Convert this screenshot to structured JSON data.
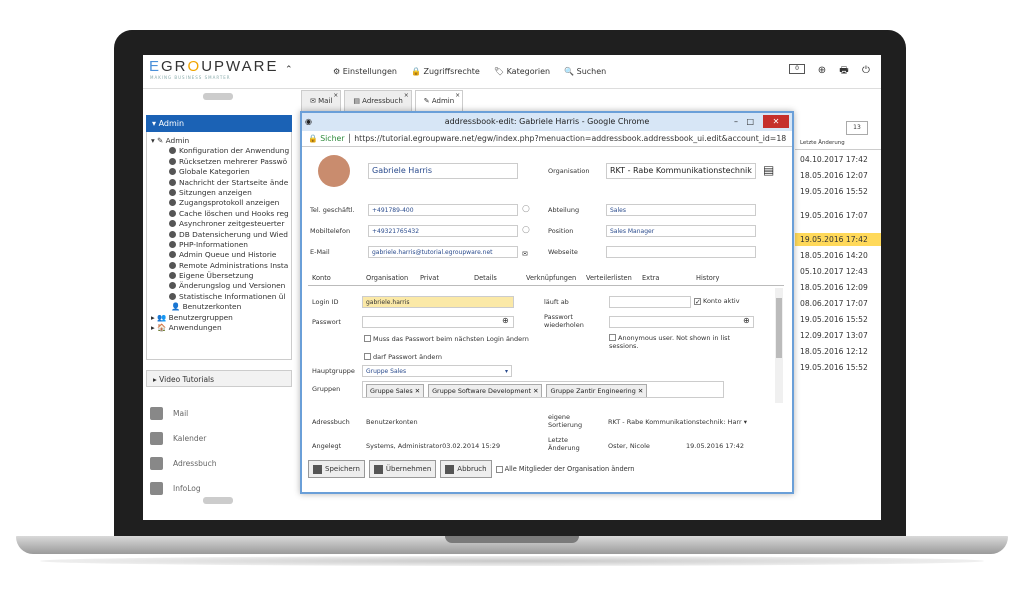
{
  "logo": {
    "text": "EGROUPWARE",
    "tagline": "MAKING BUSINESS SMARTER"
  },
  "menu": [
    "Einstellungen",
    "Zugriffsrechte",
    "Kategorien",
    "Suchen"
  ],
  "notifications": "0",
  "tabs": [
    {
      "label": "Mail"
    },
    {
      "label": "Adressbuch"
    },
    {
      "label": "Admin"
    }
  ],
  "sidebar": {
    "header": "Admin",
    "root": "Admin",
    "items": [
      "Konfiguration der Anwendung",
      "Rücksetzen mehrerer Passwö",
      "Globale Kategorien",
      "Nachricht der Startseite ände",
      "Sitzungen anzeigen",
      "Zugangsprotokoll anzeigen",
      "Cache löschen und Hooks reg",
      "Asynchroner zeitgesteuerter",
      "DB Datensicherung und Wied",
      "PHP-Informationen",
      "Admin Queue und Historie",
      "Remote Administrations Insta",
      "Eigene Übersetzung",
      "Änderungslog und Versionen",
      "Statistische Informationen ül"
    ],
    "groups": [
      "Benutzerkonten",
      "Benutzergruppen",
      "Anwendungen"
    ],
    "video": "Video Tutorials",
    "apps": [
      "Mail",
      "Kalender",
      "Adressbuch",
      "InfoLog"
    ]
  },
  "right": {
    "count": "13",
    "header": "Letzte Änderung",
    "rows": [
      "04.10.2017 17:42",
      "18.05.2016 12:07",
      "19.05.2016 15:52",
      "19.05.2016 17:07",
      "19.05.2016 17:42",
      "18.05.2016 14:20",
      "05.10.2017 12:43",
      "18.05.2016 12:09",
      "08.06.2017 17:07",
      "19.05.2016 15:52",
      "12.09.2017 13:07",
      "18.05.2016 12:12",
      "19.05.2016 15:52"
    ],
    "highlight_index": 4
  },
  "popup": {
    "title": "addressbook-edit: Gabriele Harris - Google Chrome",
    "secure": "Sicher",
    "url": "https://tutorial.egroupware.net/egw/index.php?menuaction=addressbook.addressbook_ui.edit&account_id=18",
    "name": "Gabriele Harris",
    "org_label": "Organisation",
    "org_value": "RKT - Rabe Kommunikationstechnik",
    "tel_label": "Tel. geschäftl.",
    "tel": "+491789-400",
    "mobile_label": "Mobiltelefon",
    "mobile": "+49321765432",
    "email_label": "E-Mail",
    "email": "gabriele.harris@tutorial.egroupware.net",
    "dept_label": "Abteilung",
    "dept": "Sales",
    "pos_label": "Position",
    "pos": "Sales Manager",
    "web_label": "Webseite",
    "ptabs": [
      "Konto",
      "Organisation",
      "Privat",
      "Details",
      "Verknüpfungen",
      "Verteilerlisten",
      "Extra",
      "History"
    ],
    "loginid_label": "Login ID",
    "loginid": "gabriele.harris",
    "expires_label": "läuft ab",
    "account_active": "Konto aktiv",
    "password_label": "Passwort",
    "password2_label": "Passwort wiederholen",
    "must_change": "Muss das Passwort beim nächsten Login ändern",
    "may_change": "darf Passwort ändern",
    "anonymous": "Anonymous user. Not shown in list sessions.",
    "primary_group_label": "Hauptgruppe",
    "primary_group": "Gruppe Sales",
    "groups_label": "Gruppen",
    "groups": [
      "Gruppe Sales",
      "Gruppe Software Development",
      "Gruppe Zantir Engineering"
    ],
    "addressbook_label": "Adressbuch",
    "addressbook": "Benutzerkonten",
    "own_sort_label": "eigene Sortierung",
    "own_sort": "RKT - Rabe Kommunikationstechnik: Harr",
    "created_label": "Angelegt",
    "created": "Systems, Administrator03.02.2014 15:29",
    "modified_label": "Letzte Änderung",
    "modified_by": "Oster, Nicole",
    "modified": "19.05.2016 17:42",
    "buttons": [
      "Speichern",
      "Übernehmen",
      "Abbruch"
    ],
    "all_members": "Alle Mitglieder der Organisation ändern"
  }
}
